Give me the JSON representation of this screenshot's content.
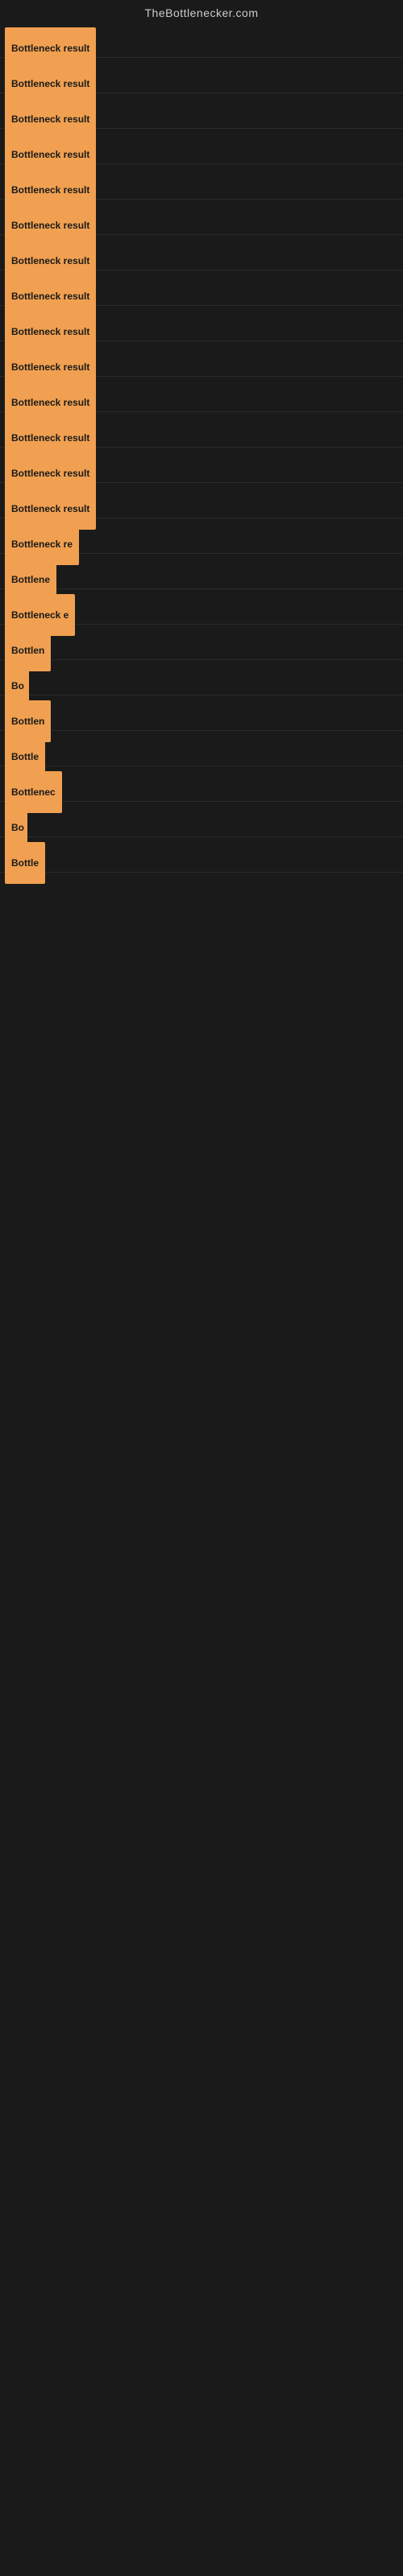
{
  "site": {
    "title": "TheBottlenecker.com"
  },
  "items": [
    {
      "label": "Bottleneck result",
      "width": 130,
      "row": 1
    },
    {
      "label": "Bottleneck result",
      "width": 130,
      "row": 2
    },
    {
      "label": "Bottleneck result",
      "width": 130,
      "row": 3
    },
    {
      "label": "Bottleneck result",
      "width": 130,
      "row": 4
    },
    {
      "label": "Bottleneck result",
      "width": 130,
      "row": 5
    },
    {
      "label": "Bottleneck result",
      "width": 130,
      "row": 6
    },
    {
      "label": "Bottleneck result",
      "width": 130,
      "row": 7
    },
    {
      "label": "Bottleneck result",
      "width": 130,
      "row": 8
    },
    {
      "label": "Bottleneck result",
      "width": 130,
      "row": 9
    },
    {
      "label": "Bottleneck result",
      "width": 130,
      "row": 10
    },
    {
      "label": "Bottleneck result",
      "width": 130,
      "row": 11
    },
    {
      "label": "Bottleneck result",
      "width": 130,
      "row": 12
    },
    {
      "label": "Bottleneck result",
      "width": 130,
      "row": 13
    },
    {
      "label": "Bottleneck result",
      "width": 130,
      "row": 14
    },
    {
      "label": "Bottleneck re",
      "width": 100,
      "row": 15
    },
    {
      "label": "Bottlene",
      "width": 75,
      "row": 16
    },
    {
      "label": "Bottleneck e",
      "width": 90,
      "row": 17
    },
    {
      "label": "Bottlen",
      "width": 68,
      "row": 18
    },
    {
      "label": "Bo",
      "width": 30,
      "row": 19
    },
    {
      "label": "Bottlen",
      "width": 68,
      "row": 20
    },
    {
      "label": "Bottle",
      "width": 55,
      "row": 21
    },
    {
      "label": "Bottlenec",
      "width": 80,
      "row": 22
    },
    {
      "label": "Bo",
      "width": 28,
      "row": 23
    },
    {
      "label": "Bottle",
      "width": 55,
      "row": 24
    }
  ]
}
